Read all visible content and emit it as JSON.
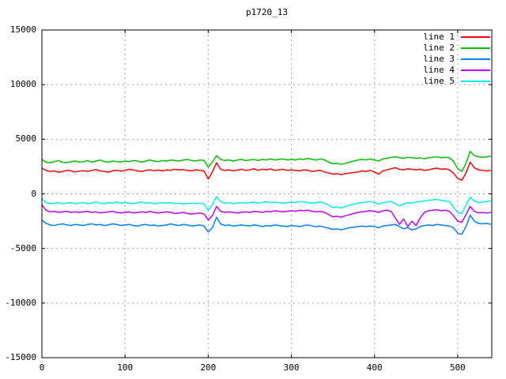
{
  "window": {
    "background": "#ffffff"
  },
  "style": {
    "grid_color": "#9e9e9e",
    "border_color": "#000000",
    "text_color": "#000000",
    "line_width": 1.5
  },
  "chart_data": {
    "type": "line",
    "title": "p1720_13",
    "xlabel": "",
    "ylabel": "",
    "xlim": [
      0,
      541
    ],
    "ylim": [
      -15000,
      15000
    ],
    "xticks": [
      0,
      100,
      200,
      300,
      400,
      500
    ],
    "yticks": [
      -15000,
      -10000,
      -5000,
      0,
      5000,
      10000,
      15000
    ],
    "grid": true,
    "grid_style": "dashed",
    "legend_position": "top-right-inside",
    "x_start": 0,
    "x_step": 5,
    "series": [
      {
        "name": "line 1",
        "color": "#ff0000",
        "values": [
          2350,
          2150,
          2050,
          2100,
          1980,
          2050,
          2150,
          2100,
          2000,
          2080,
          2120,
          2060,
          2150,
          2230,
          2100,
          2050,
          1980,
          2100,
          2160,
          2080,
          2150,
          2250,
          2180,
          2100,
          2050,
          2150,
          2200,
          2120,
          2180,
          2100,
          2200,
          2150,
          2250,
          2180,
          2220,
          2150,
          2100,
          2200,
          2150,
          2100,
          1350,
          2000,
          2850,
          2250,
          2150,
          2200,
          2100,
          2180,
          2250,
          2150,
          2200,
          2300,
          2150,
          2250,
          2200,
          2280,
          2150,
          2200,
          2250,
          2150,
          2200,
          2150,
          2100,
          2200,
          2150,
          2050,
          2100,
          2150,
          2000,
          1900,
          1800,
          1850,
          1750,
          1850,
          1900,
          1950,
          2000,
          2100,
          2050,
          2150,
          2000,
          1800,
          2100,
          2200,
          2300,
          2400,
          2250,
          2200,
          2300,
          2250,
          2200,
          2250,
          2150,
          2200,
          2300,
          2350,
          2250,
          2300,
          2200,
          1900,
          1400,
          1250,
          1900,
          2900,
          2400,
          2200,
          2150,
          2100,
          2150
        ]
      },
      {
        "name": "line 2",
        "color": "#00c000",
        "values": [
          3150,
          2900,
          2850,
          2950,
          3050,
          2900,
          2850,
          2950,
          3000,
          2900,
          2950,
          3050,
          2900,
          3000,
          3100,
          2950,
          2900,
          3000,
          2950,
          2900,
          3000,
          2950,
          3050,
          3000,
          2900,
          3000,
          3100,
          3000,
          2950,
          3050,
          3000,
          3100,
          3050,
          3000,
          3100,
          3150,
          3050,
          3000,
          3100,
          3050,
          2450,
          2900,
          3500,
          3150,
          3050,
          3100,
          3000,
          3100,
          3150,
          3050,
          3100,
          3150,
          3050,
          3150,
          3100,
          3200,
          3100,
          3150,
          3200,
          3100,
          3150,
          3100,
          3200,
          3150,
          3250,
          3150,
          3100,
          3200,
          3100,
          2900,
          2750,
          2800,
          2700,
          2800,
          2900,
          3000,
          3100,
          3150,
          3100,
          3200,
          3100,
          3000,
          3200,
          3250,
          3350,
          3400,
          3300,
          3250,
          3350,
          3300,
          3250,
          3300,
          3200,
          3300,
          3350,
          3400,
          3300,
          3350,
          3300,
          3000,
          2300,
          2050,
          2800,
          3900,
          3500,
          3400,
          3350,
          3400,
          3450
        ]
      },
      {
        "name": "line 3",
        "color": "#0080ff",
        "values": [
          -2400,
          -2700,
          -2850,
          -2900,
          -2800,
          -2750,
          -2850,
          -2900,
          -2800,
          -2850,
          -2900,
          -2800,
          -2750,
          -2850,
          -2800,
          -2900,
          -2850,
          -2750,
          -2800,
          -2900,
          -2850,
          -2800,
          -2900,
          -2950,
          -2850,
          -2800,
          -2900,
          -2850,
          -2950,
          -2900,
          -2850,
          -2750,
          -2850,
          -2900,
          -2800,
          -2850,
          -2950,
          -2900,
          -2850,
          -2950,
          -3500,
          -3100,
          -2150,
          -2750,
          -2900,
          -2850,
          -2950,
          -2900,
          -2850,
          -2900,
          -2950,
          -2850,
          -2900,
          -3000,
          -2900,
          -2950,
          -2850,
          -2900,
          -2950,
          -3000,
          -2900,
          -2950,
          -3000,
          -2900,
          -2850,
          -2950,
          -3000,
          -2950,
          -3050,
          -3150,
          -3250,
          -3200,
          -3300,
          -3200,
          -3100,
          -3050,
          -3000,
          -2950,
          -3000,
          -2950,
          -3000,
          -3100,
          -2950,
          -2900,
          -2850,
          -2800,
          -3000,
          -3200,
          -3100,
          -3300,
          -3200,
          -3000,
          -2900,
          -2850,
          -2900,
          -2800,
          -2850,
          -2900,
          -2950,
          -3100,
          -3600,
          -3700,
          -3000,
          -1950,
          -2500,
          -2700,
          -2750,
          -2700,
          -2800
        ]
      },
      {
        "name": "line 4",
        "color": "#c000ff",
        "values": [
          -1000,
          -1500,
          -1650,
          -1600,
          -1700,
          -1650,
          -1600,
          -1700,
          -1650,
          -1700,
          -1650,
          -1600,
          -1700,
          -1650,
          -1750,
          -1700,
          -1650,
          -1600,
          -1700,
          -1750,
          -1700,
          -1650,
          -1750,
          -1700,
          -1650,
          -1700,
          -1600,
          -1700,
          -1750,
          -1700,
          -1650,
          -1700,
          -1800,
          -1750,
          -1700,
          -1800,
          -1850,
          -1800,
          -1750,
          -1850,
          -2400,
          -2000,
          -1150,
          -1600,
          -1700,
          -1650,
          -1700,
          -1750,
          -1700,
          -1650,
          -1700,
          -1600,
          -1650,
          -1700,
          -1600,
          -1650,
          -1550,
          -1600,
          -1650,
          -1600,
          -1550,
          -1600,
          -1500,
          -1550,
          -1500,
          -1600,
          -1650,
          -1600,
          -1700,
          -1900,
          -2100,
          -2050,
          -2150,
          -2000,
          -1900,
          -1800,
          -1700,
          -1650,
          -1600,
          -1550,
          -1600,
          -1700,
          -1550,
          -1500,
          -1600,
          -2200,
          -2800,
          -2300,
          -3000,
          -2500,
          -2900,
          -2200,
          -1700,
          -1550,
          -1500,
          -1450,
          -1550,
          -1500,
          -1600,
          -2000,
          -2500,
          -2600,
          -1900,
          -1150,
          -1600,
          -1750,
          -1700,
          -1750,
          -1700
        ]
      },
      {
        "name": "line 5",
        "color": "#00eeee",
        "values": [
          -450,
          -800,
          -900,
          -850,
          -800,
          -900,
          -850,
          -800,
          -900,
          -850,
          -800,
          -900,
          -850,
          -750,
          -850,
          -900,
          -800,
          -850,
          -750,
          -850,
          -800,
          -850,
          -900,
          -800,
          -750,
          -850,
          -800,
          -900,
          -850,
          -800,
          -850,
          -800,
          -900,
          -850,
          -950,
          -900,
          -850,
          -900,
          -850,
          -950,
          -1500,
          -1000,
          -250,
          -700,
          -850,
          -800,
          -900,
          -850,
          -800,
          -850,
          -800,
          -750,
          -850,
          -800,
          -700,
          -800,
          -750,
          -800,
          -850,
          -800,
          -750,
          -800,
          -700,
          -750,
          -800,
          -850,
          -800,
          -750,
          -850,
          -1050,
          -1250,
          -1200,
          -1300,
          -1150,
          -1050,
          -950,
          -850,
          -800,
          -750,
          -700,
          -800,
          -950,
          -800,
          -750,
          -700,
          -900,
          -1100,
          -950,
          -800,
          -850,
          -750,
          -700,
          -650,
          -600,
          -550,
          -500,
          -600,
          -650,
          -700,
          -1200,
          -1700,
          -1800,
          -1000,
          -300,
          -650,
          -800,
          -750,
          -700,
          -650
        ]
      }
    ]
  }
}
